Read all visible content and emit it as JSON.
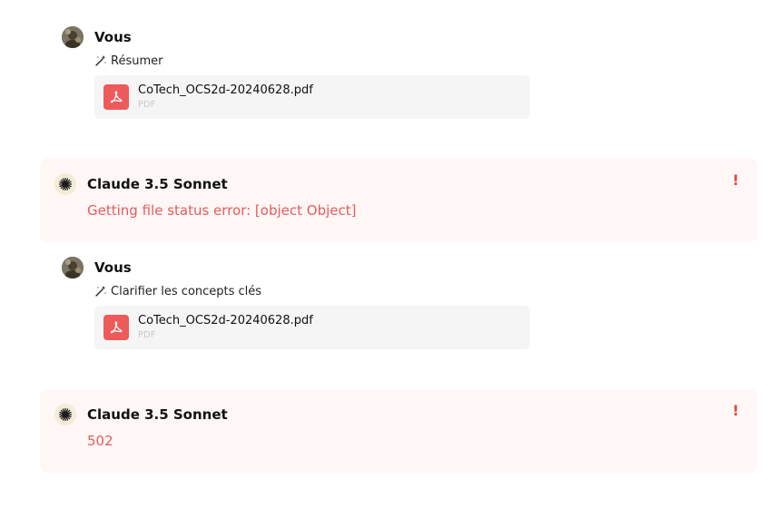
{
  "messages": [
    {
      "role": "user",
      "author": "Vous",
      "action": "Résumer",
      "action_icon": "magic-wand-icon",
      "file": {
        "name": "CoTech_OCS2d-20240628.pdf",
        "type": "PDF",
        "icon": "pdf-file-icon"
      }
    },
    {
      "role": "assistant",
      "author": "Claude 3.5 Sonnet",
      "text": "Getting file status error: [object Object]",
      "flag": "!"
    },
    {
      "role": "user",
      "author": "Vous",
      "action": "Clarifier les concepts clés",
      "action_icon": "magic-wand-icon",
      "file": {
        "name": "CoTech_OCS2d-20240628.pdf",
        "type": "PDF",
        "icon": "pdf-file-icon"
      }
    },
    {
      "role": "assistant",
      "author": "Claude 3.5 Sonnet",
      "text": "502",
      "flag": "!"
    }
  ],
  "colors": {
    "error_text": "#e35d5d",
    "error_background": "#fff6f6",
    "pdf_icon": "#ee5a5a",
    "file_card": "#f5f5f5"
  }
}
